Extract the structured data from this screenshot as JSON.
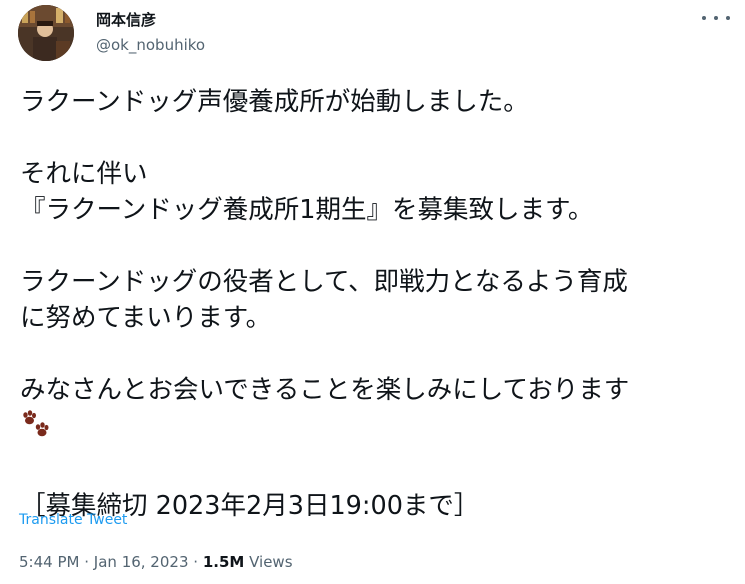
{
  "author": {
    "display_name": "岡本信彦",
    "handle": "@ok_nobuhiko"
  },
  "menu": {
    "icon": "more-horizontal-icon"
  },
  "tweet": {
    "lines": [
      "ラクーンドッグ声優養成所が始動しました。",
      "それに伴い",
      "『ラクーンドッグ養成所1期生』を募集致します。",
      "ラクーンドッグの役者として、即戦力となるよう育成",
      "に努めてまいります。",
      "みなさんとお会いできることを楽しみにしております",
      "［募集締切 2023年2月3日19:00まで］"
    ],
    "emoji": "paw-prints-icon"
  },
  "translate_label": "Translate Tweet",
  "meta": {
    "time": "5:44 PM",
    "separator": "·",
    "date": "Jan 16, 2023",
    "views_count": "1.5M",
    "views_label": "Views"
  },
  "colors": {
    "text": "#0f1419",
    "secondary": "#536471",
    "link": "#1d9bf0",
    "paw": "#7a2a1c"
  }
}
